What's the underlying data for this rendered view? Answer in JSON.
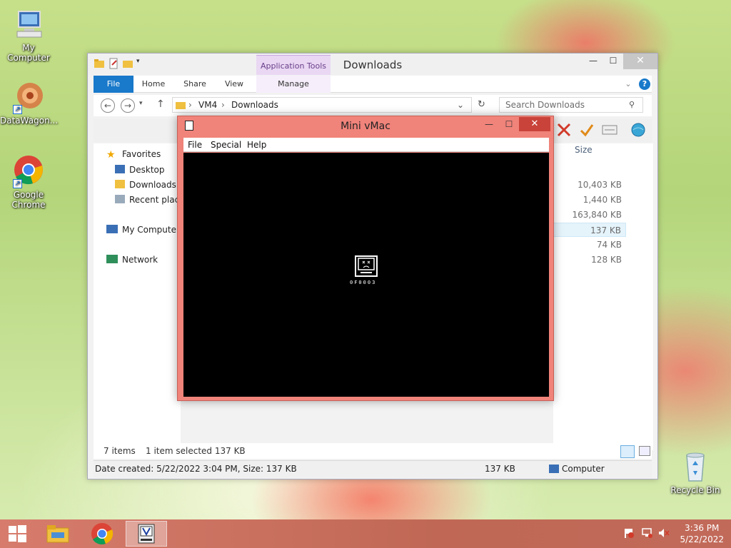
{
  "desktop": {
    "icons": [
      {
        "label": "My Computer"
      },
      {
        "label": "DataWagon..."
      },
      {
        "label": "Google Chrome"
      },
      {
        "label": "Recycle Bin"
      }
    ]
  },
  "explorer": {
    "title": "Downloads",
    "context_tab": "Application Tools",
    "tabs": [
      "File",
      "Home",
      "Share",
      "View",
      "Manage"
    ],
    "address": {
      "parts": [
        "VM4",
        "Downloads"
      ]
    },
    "search": {
      "placeholder": "Search Downloads"
    },
    "nav": {
      "favorites": "Favorites",
      "items": [
        "Desktop",
        "Downloads",
        "Recent places"
      ],
      "computer": "My Computer",
      "network": "Network"
    },
    "columns": {
      "size": "Size"
    },
    "sizes": [
      "10,403 KB",
      "1,440 KB",
      "163,840 KB",
      "137 KB",
      "74 KB",
      "128 KB"
    ],
    "status": {
      "items": "7 items",
      "selected": "1 item selected  137 KB"
    },
    "details": {
      "created": "Date created: 5/22/2022 3:04 PM, Size: 137 KB",
      "size": "137 KB",
      "location": "Computer"
    }
  },
  "vmac": {
    "title": "Mini vMac",
    "menu": [
      "File",
      "Special",
      "Help"
    ],
    "error_code": "0F0003"
  },
  "taskbar": {
    "time": "3:36 PM",
    "date": "5/22/2022"
  },
  "colors": {
    "file_tab": "#1979ca",
    "vmac_frame": "#f0837a",
    "taskbar": "#c06855"
  }
}
